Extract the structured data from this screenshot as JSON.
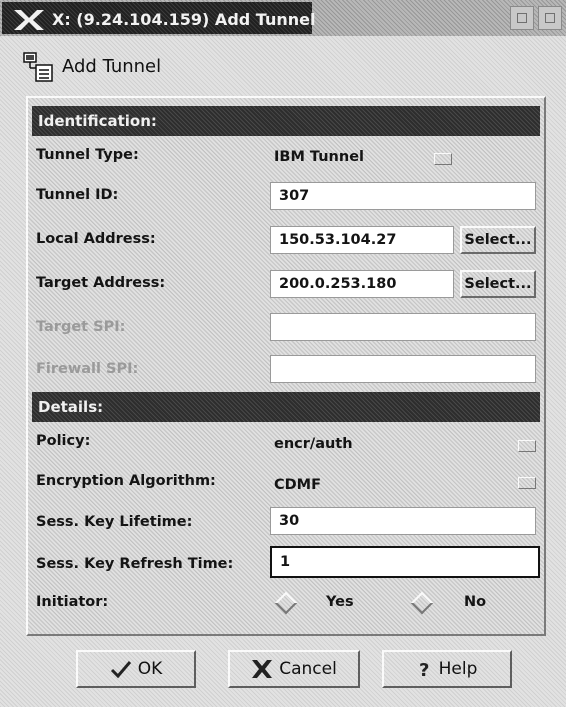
{
  "window": {
    "title": "X: (9.24.104.159) Add Tunnel"
  },
  "header": {
    "title": "Add Tunnel",
    "icon": "tunnel-config-icon"
  },
  "sections": {
    "identification": "Identification:",
    "details": "Details:"
  },
  "identification": {
    "tunnel_type_label": "Tunnel Type:",
    "tunnel_type_value": "IBM Tunnel",
    "tunnel_id_label": "Tunnel ID:",
    "tunnel_id_value": "307",
    "local_address_label": "Local Address:",
    "local_address_value": "150.53.104.27",
    "target_address_label": "Target Address:",
    "target_address_value": "200.0.253.180",
    "target_spi_label": "Target SPI:",
    "target_spi_value": "",
    "firewall_spi_label": "Firewall SPI:",
    "firewall_spi_value": "",
    "select_label": "Select..."
  },
  "details": {
    "policy_label": "Policy:",
    "policy_value": "encr/auth",
    "encryption_label": "Encryption Algorithm:",
    "encryption_value": "CDMF",
    "sess_key_lifetime_label": "Sess. Key Lifetime:",
    "sess_key_lifetime_value": "30",
    "sess_key_refresh_label": "Sess. Key Refresh Time:",
    "sess_key_refresh_value": "1",
    "initiator_label": "Initiator:",
    "initiator_yes": "Yes",
    "initiator_no": "No"
  },
  "buttons": {
    "ok": "OK",
    "cancel": "Cancel",
    "help": "Help"
  }
}
